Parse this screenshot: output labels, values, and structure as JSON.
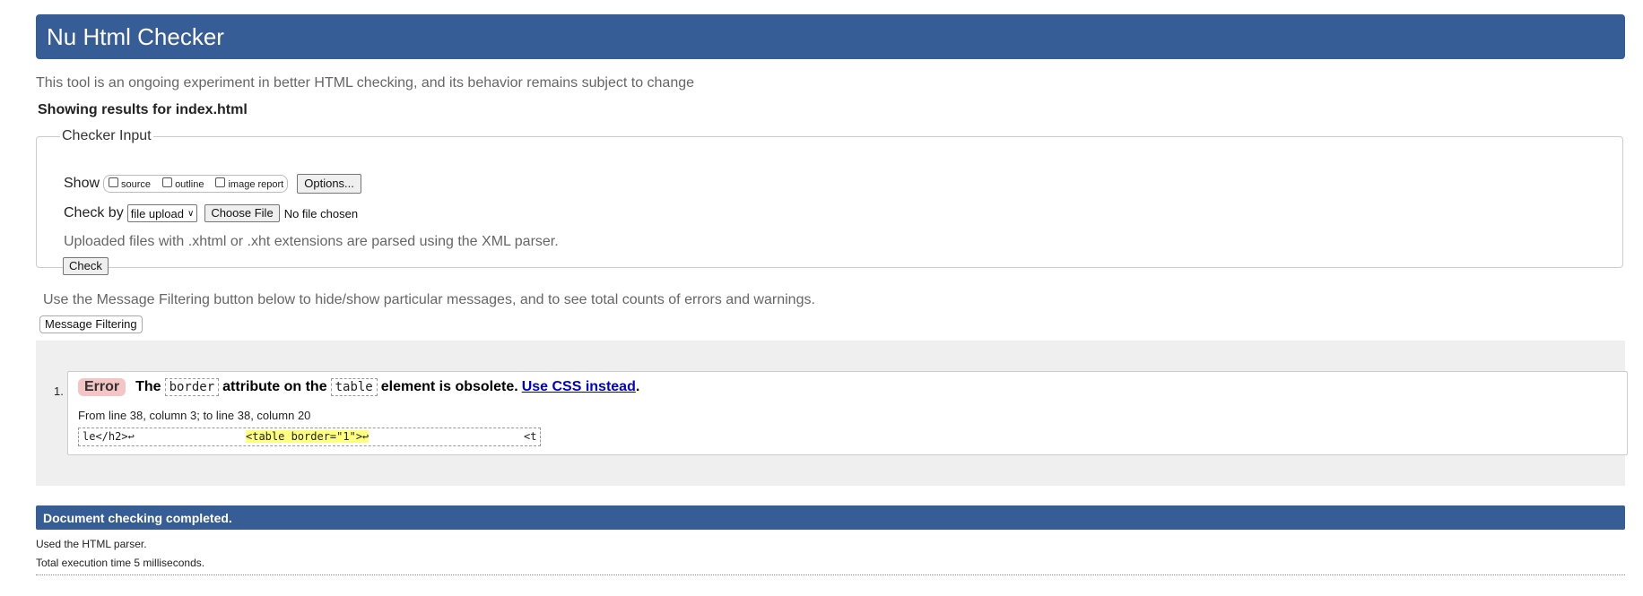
{
  "header": {
    "title": "Nu Html Checker"
  },
  "intro": "This tool is an ongoing experiment in better HTML checking, and its behavior remains subject to change",
  "results_for": "Showing results for index.html",
  "checker_input": {
    "legend": "Checker Input",
    "show_label": "Show",
    "show_options": [
      "source",
      "outline",
      "image report"
    ],
    "options_button": "Options...",
    "check_by_label": "Check by",
    "check_by_value": "file upload",
    "choose_file_button": "Choose File",
    "no_file_text": "No file chosen",
    "upload_note": "Uploaded files with .xhtml or .xht extensions are parsed using the XML parser.",
    "check_button": "Check"
  },
  "filter_note": "Use the Message Filtering button below to hide/show particular messages, and to see total counts of errors and warnings.",
  "filter_button": "Message Filtering",
  "messages": [
    {
      "number": "1.",
      "type": "Error",
      "text_parts": [
        "The",
        "border",
        "attribute on the",
        "table",
        "element is obsolete."
      ],
      "link_text": "Use CSS instead",
      "trailing": ".",
      "location": "From line 38, column 3; to line 38, column 20",
      "extract_pre": "le</h2>↩",
      "extract_highlight": "<table border=\"1\">↩",
      "extract_post": "<t"
    }
  ],
  "footer": {
    "status": "Document checking completed.",
    "parser_note": "Used the HTML parser.",
    "exec_note": "Total execution time 5 milliseconds."
  },
  "colors": {
    "header_bg": "#365d95",
    "error_badge_bg": "#f4c5c5",
    "highlight": "#ffff80",
    "link": "#0000cc"
  }
}
